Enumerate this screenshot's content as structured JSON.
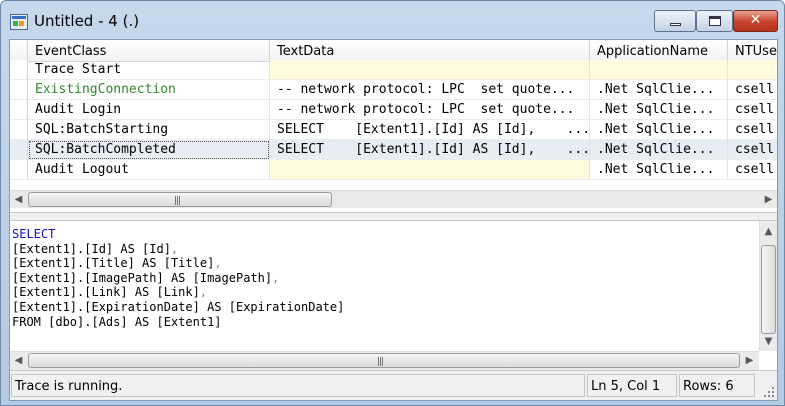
{
  "window": {
    "title": "Untitled - 4 (.)",
    "close_glyph": "✕"
  },
  "grid": {
    "columns": [
      "EventClass",
      "TextData",
      "ApplicationName",
      "NTUse"
    ],
    "rows": [
      {
        "event": "Trace Start",
        "text": "",
        "app": "",
        "user": ""
      },
      {
        "event": "ExistingConnection",
        "text": "-- network protocol: LPC  set quote...",
        "app": ".Net SqlClie...",
        "user": "csell"
      },
      {
        "event": "Audit Login",
        "text": "-- network protocol: LPC  set quote...",
        "app": ".Net SqlClie...",
        "user": "csell"
      },
      {
        "event": "SQL:BatchStarting",
        "text": "SELECT    [Extent1].[Id] AS [Id],    ...",
        "app": ".Net SqlClie...",
        "user": "csell"
      },
      {
        "event": "SQL:BatchCompleted",
        "text": "SELECT    [Extent1].[Id] AS [Id],    ...",
        "app": ".Net SqlClie...",
        "user": "csell"
      },
      {
        "event": "Audit Logout",
        "text": "",
        "app": ".Net SqlClie...",
        "user": "csell"
      }
    ]
  },
  "sql": {
    "keyword_select": "SELECT",
    "l2": "[Extent1]",
    "l2b": ".[Id] AS [Id]",
    "l3": "[Extent1]",
    "l3b": ".[Title] AS [Title]",
    "l4": "[Extent1]",
    "l4b": ".[ImagePath] AS [ImagePath]",
    "l5": "[Extent1]",
    "l5b": ".[Link] AS [Link]",
    "l6": "[Extent1]",
    "l6b": ".[ExpirationDate] AS [ExpirationDate]",
    "from_line": "FROM [dbo].[Ads] AS [Extent1]",
    "comma": ","
  },
  "status": {
    "message": "Trace is running.",
    "position": "Ln 5, Col 1",
    "rows": "Rows: 6"
  },
  "icons": {
    "scroll_left": "◀",
    "scroll_right": "▶",
    "scroll_up": "▲",
    "scroll_down": "▼",
    "grip": "|||"
  }
}
